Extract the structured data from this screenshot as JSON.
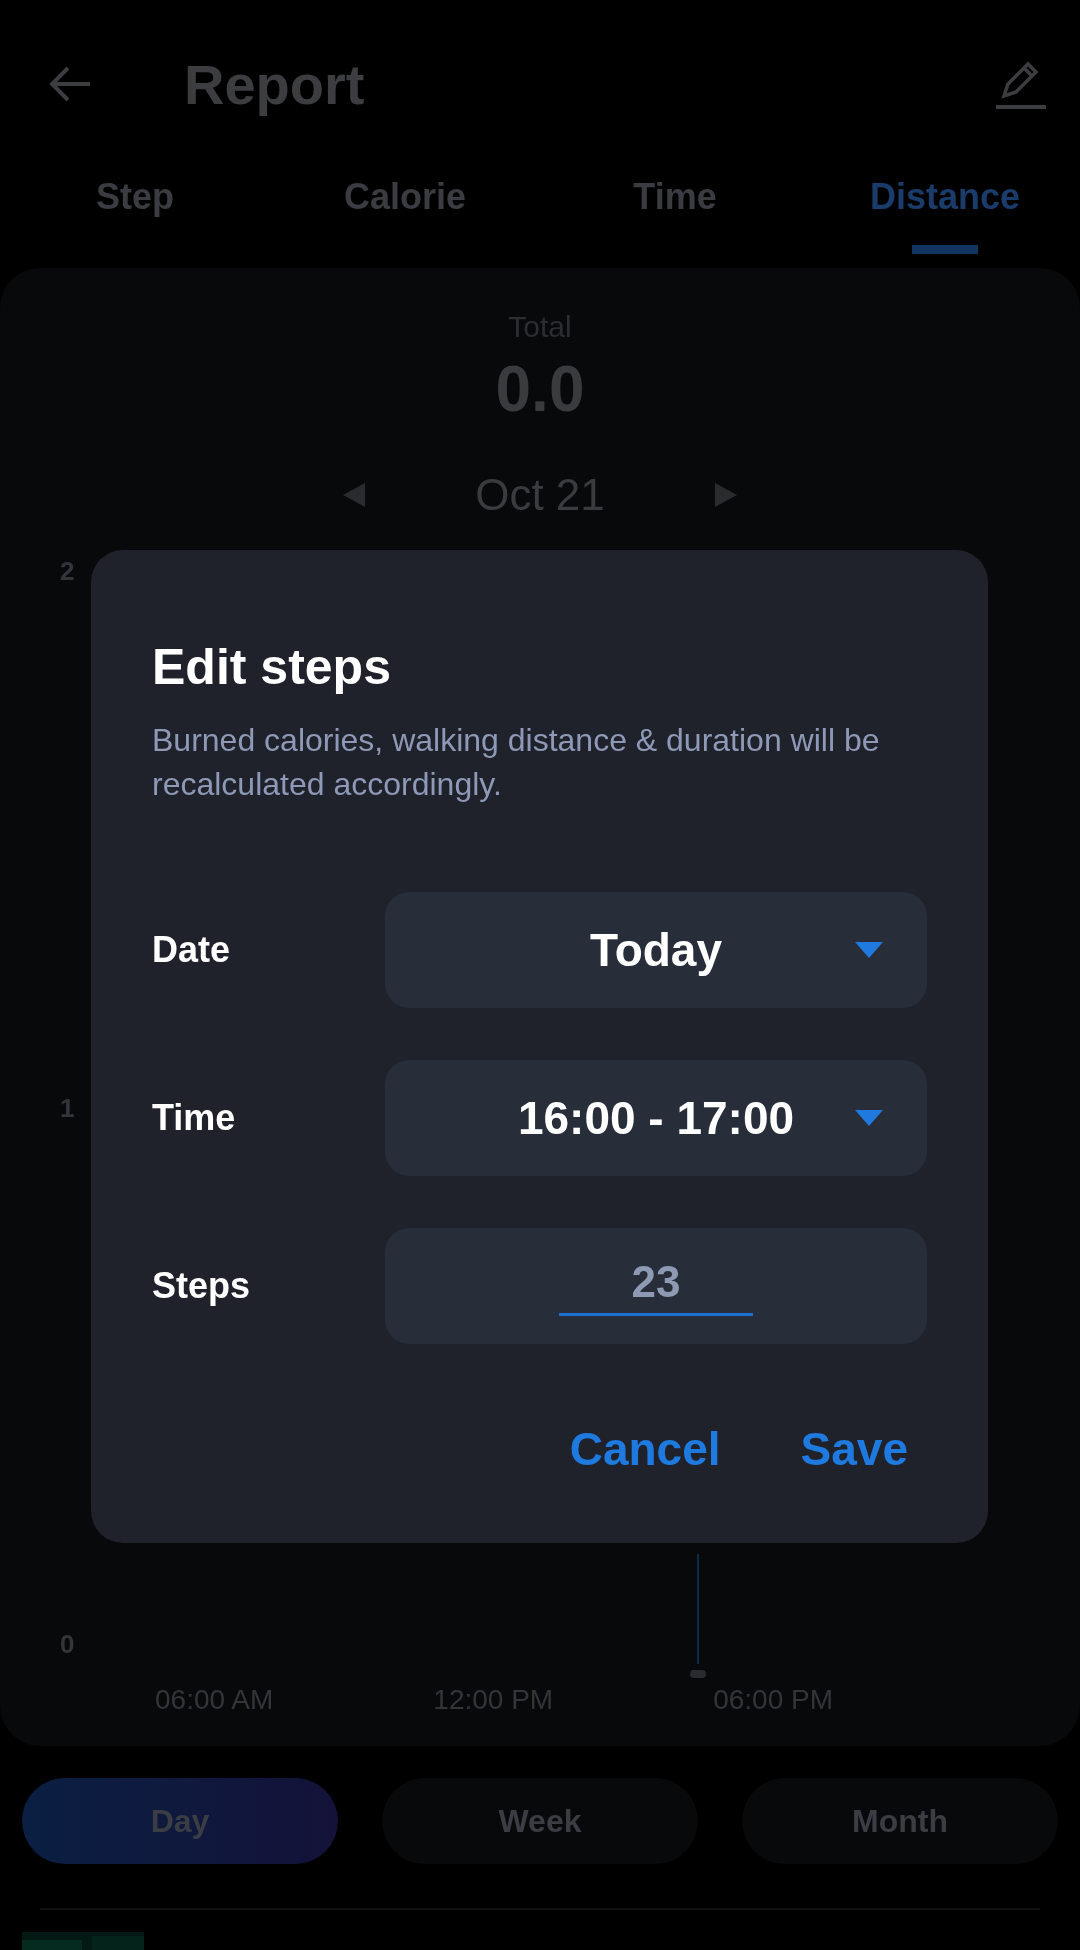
{
  "header": {
    "title": "Report"
  },
  "tabs": [
    {
      "label": "Step",
      "selected": false
    },
    {
      "label": "Calorie",
      "selected": false
    },
    {
      "label": "Time",
      "selected": false
    },
    {
      "label": "Distance",
      "selected": true
    }
  ],
  "summary": {
    "label": "Total",
    "value": "0.0",
    "date": "Oct 21"
  },
  "chart": {
    "y_labels": [
      "2",
      "1",
      "0"
    ],
    "x_labels": [
      "06:00 AM",
      "12:00 PM",
      "06:00 PM"
    ]
  },
  "periods": [
    {
      "label": "Day",
      "selected": true
    },
    {
      "label": "Week",
      "selected": false
    },
    {
      "label": "Month",
      "selected": false
    }
  ],
  "dialog": {
    "title": "Edit steps",
    "description": "Burned calories, walking distance & duration will be recalculated accordingly.",
    "fields": [
      {
        "kind": "dropdown",
        "label": "Date",
        "value": "Today"
      },
      {
        "kind": "dropdown",
        "label": "Time",
        "value": "16:00 - 17:00"
      },
      {
        "kind": "input",
        "label": "Steps",
        "value": "23"
      }
    ],
    "buttons": [
      "Cancel",
      "Save"
    ]
  }
}
